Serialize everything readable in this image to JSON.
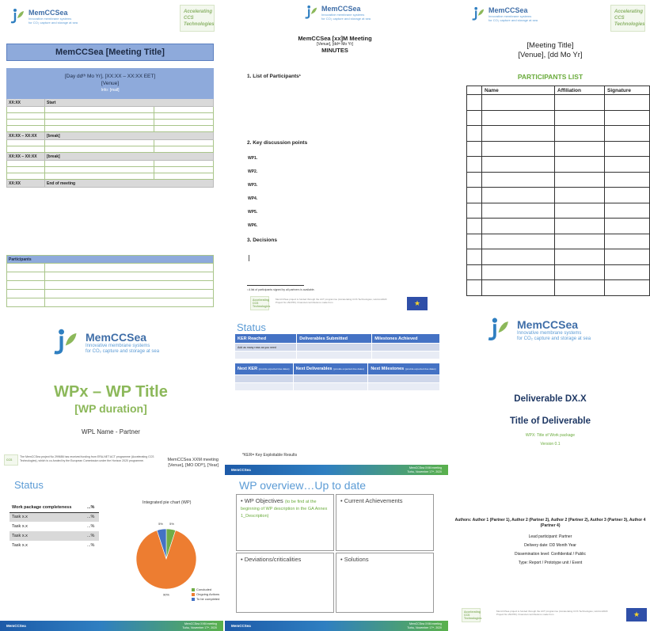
{
  "colors": {
    "accent_blue": "#5b9bd5",
    "brand_blue": "#3f6ea8",
    "brand_green": "#8cb85a",
    "table_header": "#8eaadb",
    "status_header": "#4472c4",
    "pie_concluded": "#70ad47",
    "pie_ongoing": "#ed7d31",
    "pie_todo": "#4472c4"
  },
  "brand": {
    "name": "MemCCSea",
    "tagline1": "Innovative membrane systems",
    "tagline2": "for CO₂ capture and storage at sea",
    "logo_icon": "memccsea-logo-icon",
    "acc_line1": "Accelerating",
    "acc_line2": "CCS",
    "acc_line3": "Technologies"
  },
  "agenda": {
    "title": "MemCCSea [Meeting Title]",
    "date_line": "[Day ddᵗʰ Mo Yr], [XX:XX – XX:XX EET]",
    "venue": "[Venue]",
    "info": "Info: [mail]",
    "rows": [
      {
        "time": "XX:XX",
        "label": "Start"
      },
      {
        "time": "XX:XX – XX:XX",
        "label": "[break]"
      },
      {
        "time": "XX:XX – XX:XX",
        "label": "[break]"
      },
      {
        "time": "XX:XX",
        "label": "End of meeting"
      }
    ],
    "participants_header": "Participants"
  },
  "minutes": {
    "title": "MemCCSea [xx]M Meeting",
    "venue_line": "[Venue], [ddᵗʰ Mo Yr]",
    "heading": "MINUTES",
    "section1": "1.  List of Participants¹",
    "section2": "2.  Key discussion points",
    "wps": [
      "WP1.",
      "WP2.",
      "WP3.",
      "WP4.",
      "WP5.",
      "WP6."
    ],
    "section3": "3.  Decisions",
    "footnote": "¹ A list of participants signed by all partners is available.",
    "funding": "MemCCSea project is funded through the ACT programme (Accelerating CCS Technologies, Horizon2020 Project No 294766). Financial contributions made from"
  },
  "participants_list": {
    "meeting_title": "[Meeting Title]",
    "venue_date": "[Venue], [dd Mo Yr]",
    "heading": "PARTICIPANTS LIST",
    "columns": [
      "Name",
      "Affiliation",
      "Signature"
    ]
  },
  "wp_title": {
    "title": "WPx – WP Title",
    "duration": "[WP duration]",
    "leader": "WPL Name - Partner"
  },
  "status_table": {
    "title": "Status",
    "headers1": [
      "KER Reached",
      "Deliverables Submitted",
      "Milestones Achieved"
    ],
    "note": "Add as many rows as you need",
    "headers2": [
      "Next KER",
      "Next Deliverables",
      "Next Milestones"
    ],
    "header_sub": "(provide expected due dates)",
    "footnote": "*KER= Key Exploitable Results"
  },
  "deliverable": {
    "number": "Deliverable DX.X",
    "title": "Title of Deliverable",
    "wp": "WPX: Title of Work package",
    "version": "Version 0.1",
    "authors": "Authors: Author 1 (Partner 1), Author 2 (Partner 2), Author 2 (Partner 2), Author 3 (Partner 3), Author 4 (Partner 4)",
    "lead": "Lead participant: Partner",
    "delivery": "Delivery date: DD Month Year",
    "dissemination": "Dissemination level: Confidential / Public",
    "type": "Type: Report / Prototype unit / Event",
    "funding": "MemCCSea project is funded through the ACT programme (Accelerating CCS Technologies, Horizon2020 Project No 294766). Financial contributions made from"
  },
  "status_pie": {
    "funding_note": "The MemCCSea project No 299686 has received funding from ERA-NET ACT programme (Accelerating CCS Technologies), which is co-funded by the European Commission under the Horizon 2020 programme.",
    "meeting": "MemCCSea XXM meeting",
    "venue_date": "[Venue], [MO DDᵗʰ], [Year]",
    "title": "Status",
    "table_header": [
      "Work package completeness",
      "...%"
    ],
    "tasks": [
      {
        "name": "Task x.x",
        "pct": "...%"
      },
      {
        "name": "Task x.x",
        "pct": "...%"
      },
      {
        "name": "Task x.x",
        "pct": "...%"
      },
      {
        "name": "Task x.x",
        "pct": "...%"
      }
    ],
    "pie_title": "Integrated pie chart (WP)"
  },
  "chart_data": {
    "type": "pie",
    "title": "Integrated pie chart (WP)",
    "categories": [
      "Concluded",
      "Ongoing Actions",
      "To be completed"
    ],
    "values": [
      5,
      90,
      5
    ],
    "labels": [
      "5%",
      "90%",
      "5%"
    ],
    "legend": "bottom-right"
  },
  "footer": {
    "logo": "MemCCSea",
    "meeting": "MemCCSea XXM meeting",
    "date": "Turku, November 17ᵗʰ, 2020"
  },
  "overview": {
    "title": "WP overview…Up to date",
    "objectives": "• WP Objectives",
    "objectives_note": "(to be find at the beginning of WP description in the GA Annex 1_Description)",
    "achievements": "• Current Achievements",
    "deviations": "• Deviations/criticalities",
    "solutions": "• Solutions"
  }
}
